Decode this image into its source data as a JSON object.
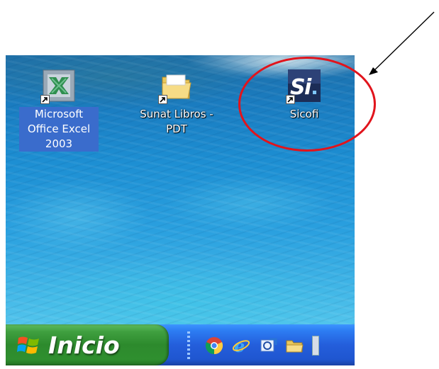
{
  "desktop": {
    "icons": [
      {
        "label": "Microsoft Office Excel 2003",
        "icon": "excel-icon",
        "selected": true
      },
      {
        "label": "Sunat Libros -PDT",
        "icon": "folder-icon",
        "selected": false
      },
      {
        "label": "Sicofi",
        "icon": "sicofi-app-icon",
        "selected": false
      }
    ]
  },
  "taskbar": {
    "start_label": "Inicio",
    "quick_launch": [
      "chrome-icon",
      "internet-explorer-icon",
      "outlook-express-icon",
      "folder-icon"
    ]
  },
  "annotation": {
    "circle_color": "#e1141c",
    "arrow_color": "#000000"
  },
  "colors": {
    "taskbar": "#245edb",
    "start_button": "#3f9f3f",
    "selection": "#3a6ccc"
  }
}
